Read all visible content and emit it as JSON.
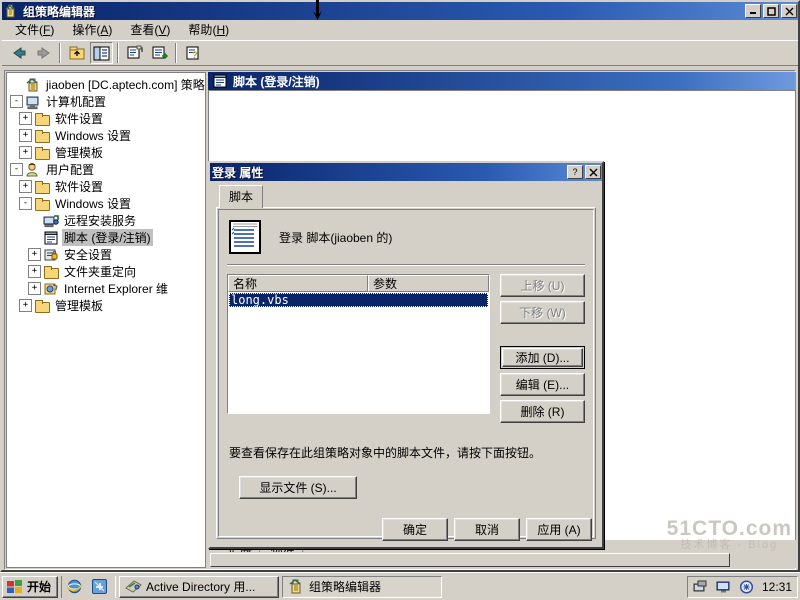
{
  "window": {
    "title": "组策略编辑器",
    "icon": "group-policy-icon",
    "buttons": {
      "minimize": "_",
      "maximize": "❐",
      "close": "✕"
    }
  },
  "menubar": {
    "items": [
      {
        "label": "文件",
        "accel": "F"
      },
      {
        "label": "操作",
        "accel": "A"
      },
      {
        "label": "查看",
        "accel": "V"
      },
      {
        "label": "帮助",
        "accel": "H"
      }
    ]
  },
  "toolbar": {
    "buttons": [
      "back-arrow-icon",
      "forward-arrow-icon",
      "up-one-level-icon",
      "show-hide-tree-icon",
      "properties-icon",
      "export-list-icon",
      "help-icon"
    ]
  },
  "tree": {
    "root": {
      "label": "jiaoben [DC.aptech.com] 策略",
      "icon": "policy-icon"
    },
    "nodes": [
      {
        "label": "计算机配置",
        "icon": "computer-icon",
        "expander": "-",
        "depth": 1
      },
      {
        "label": "软件设置",
        "icon": "folder-icon",
        "expander": "+",
        "depth": 2
      },
      {
        "label": "Windows 设置",
        "icon": "folder-icon",
        "expander": "+",
        "depth": 2
      },
      {
        "label": "管理模板",
        "icon": "folder-icon",
        "expander": "+",
        "depth": 2
      },
      {
        "label": "用户配置",
        "icon": "user-icon",
        "expander": "-",
        "depth": 1
      },
      {
        "label": "软件设置",
        "icon": "folder-icon",
        "expander": "+",
        "depth": 2
      },
      {
        "label": "Windows 设置",
        "icon": "folder-icon",
        "expander": "-",
        "depth": 2
      },
      {
        "label": "远程安装服务",
        "icon": "remote-install-icon",
        "expander": "",
        "depth": 3
      },
      {
        "label": "脚本 (登录/注销)",
        "icon": "script-icon",
        "expander": "",
        "depth": 3,
        "selected": true
      },
      {
        "label": "安全设置",
        "icon": "security-icon",
        "expander": "+",
        "depth": 3
      },
      {
        "label": "文件夹重定向",
        "icon": "folder-icon",
        "expander": "+",
        "depth": 3
      },
      {
        "label": "Internet Explorer 维",
        "icon": "ie-maintenance-icon",
        "expander": "+",
        "depth": 3
      },
      {
        "label": "管理模板",
        "icon": "folder-icon",
        "expander": "+",
        "depth": 2
      }
    ]
  },
  "right_pane": {
    "header": "脚本 (登录/注销)",
    "header_icon": "script-icon",
    "tabs": [
      {
        "label": "扩展",
        "active": false
      },
      {
        "label": "标准",
        "active": true
      }
    ]
  },
  "dialog": {
    "title": "登录 属性",
    "help_button": "?",
    "close_button": "✕",
    "tab": "脚本",
    "script_header": "登录 脚本(jiaoben 的)",
    "script_header_icon": "script-document-icon",
    "list": {
      "columns": [
        "名称",
        "参数"
      ],
      "rows": [
        {
          "name": "long.vbs",
          "params": "",
          "selected": true
        }
      ]
    },
    "buttons": {
      "move_up": {
        "label": "上移 (U)",
        "disabled": true
      },
      "move_down": {
        "label": "下移 (W)",
        "disabled": true
      },
      "add": {
        "label": "添加 (D)...",
        "default": true
      },
      "edit": {
        "label": "编辑 (E)...",
        "disabled": false
      },
      "remove": {
        "label": "删除 (R)",
        "disabled": false
      },
      "show_files": {
        "label": "显示文件 (S)..."
      },
      "ok": {
        "label": "确定"
      },
      "cancel": {
        "label": "取消"
      },
      "apply": {
        "label": "应用 (A)"
      }
    },
    "hint": "要查看保存在此组策略对象中的脚本文件，请按下面按钮。"
  },
  "taskbar": {
    "start": {
      "label": "开始",
      "icon": "windows-flag-icon"
    },
    "quicklaunch": [
      "internet-explorer-icon",
      "show-desktop-icon"
    ],
    "tasks": [
      {
        "label": "Active Directory 用...",
        "icon": "active-directory-icon",
        "active": false
      },
      {
        "label": "组策略编辑器",
        "icon": "group-policy-icon",
        "active": true
      }
    ],
    "tray": {
      "icons": [
        "network-icon",
        "display-icon",
        "shield-icon"
      ],
      "clock": "12:31"
    }
  },
  "watermark": {
    "line1": "51CTO.com",
    "line2": "技术博客 - Blog"
  },
  "colors": {
    "title_active": "#0a246a",
    "desktop": "#3a6ea5",
    "face": "#d4d0c8",
    "selection": "#0a246a"
  }
}
